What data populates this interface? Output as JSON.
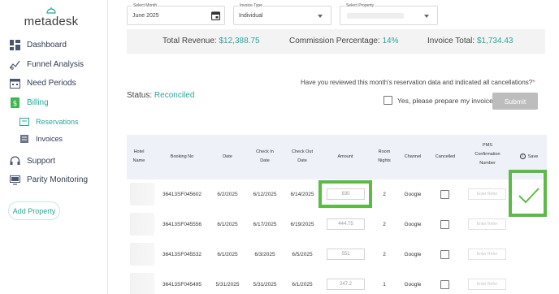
{
  "brand": {
    "name": "metadesk"
  },
  "sidebar": {
    "items": [
      {
        "label": "Dashboard",
        "icon": "dashboard-icon"
      },
      {
        "label": "Funnel Analysis",
        "icon": "funnel-analysis-icon"
      },
      {
        "label": "Need Periods",
        "icon": "calendar-icon"
      },
      {
        "label": "Billing",
        "icon": "billing-icon"
      },
      {
        "label": "Support",
        "icon": "headset-icon"
      },
      {
        "label": "Parity Monitoring",
        "icon": "monitor-icon"
      }
    ],
    "billing_sub": [
      {
        "label": "Reservations",
        "icon": "reservations-icon"
      },
      {
        "label": "Invoices",
        "icon": "invoices-icon"
      }
    ],
    "add_property": "Add Property"
  },
  "filters": {
    "month": {
      "label": "Select Month",
      "value": "June 2025"
    },
    "invoice_type": {
      "label": "Invoice Type",
      "value": "Individual"
    },
    "property": {
      "label": "Select Property",
      "value": ""
    }
  },
  "summary": {
    "revenue_label": "Total Revenue:",
    "revenue_value": "$12,388.75",
    "commission_label": "Commission Percentage:",
    "commission_value": "14%",
    "invoice_label": "Invoice Total:",
    "invoice_value": "$1,734.43"
  },
  "review": {
    "question": "Have you reviewed this month's reservation data and indicated all cancellations?",
    "required_mark": "*",
    "confirm_label": "Yes, please prepare my invoice",
    "submit_label": "Submit"
  },
  "status": {
    "label": "Status:",
    "value": "Reconciled"
  },
  "table": {
    "headers": {
      "hotel_l1": "Hotel",
      "hotel_l2": "Name",
      "booking": "Booking No",
      "date": "Date",
      "checkin_l1": "Check In",
      "checkin_l2": "Date",
      "checkout_l1": "Check Out",
      "checkout_l2": "Date",
      "amount": "Amount",
      "nights_l1": "Room",
      "nights_l2": "Nights",
      "channel": "Channel",
      "cancelled": "Cancelled",
      "pms_l1": "PMS",
      "pms_l2": "Confirmation",
      "pms_l3": "Number",
      "info_glyph": "i",
      "save": "Save"
    },
    "rows": [
      {
        "booking": "36413SF045602",
        "date": "6/2/2025",
        "checkin": "6/12/2025",
        "checkout": "6/14/2025",
        "amount": "830",
        "nights": "2",
        "channel": "Google",
        "pms_placeholder": "Enter Refer"
      },
      {
        "booking": "36413SF045556",
        "date": "6/1/2025",
        "checkin": "6/17/2025",
        "checkout": "6/19/2025",
        "amount": "444.75",
        "nights": "2",
        "channel": "Google",
        "pms_placeholder": "Enter Refer"
      },
      {
        "booking": "36413SF045532",
        "date": "6/1/2025",
        "checkin": "6/3/2025",
        "checkout": "6/5/2025",
        "amount": "551",
        "nights": "2",
        "channel": "Google",
        "pms_placeholder": "Enter Refer"
      },
      {
        "booking": "36413SF045495",
        "date": "5/31/2025",
        "checkin": "5/31/2025",
        "checkout": "6/1/2025",
        "amount": "247.2",
        "nights": "1",
        "channel": "Google",
        "pms_placeholder": "Enter Refer"
      }
    ]
  },
  "colors": {
    "accent": "#25a899",
    "highlight": "#5cba47",
    "header_bg": "#eef1f8"
  }
}
